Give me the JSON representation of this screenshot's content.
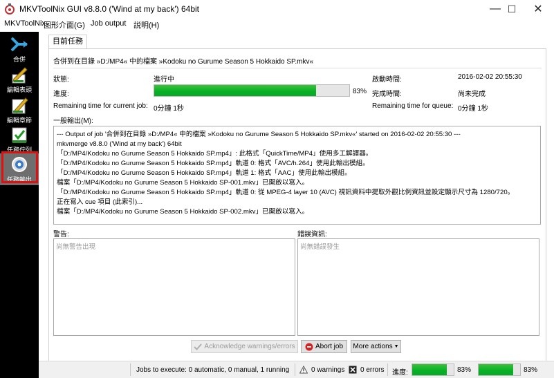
{
  "window": {
    "title": "MKVToolNix GUI v8.8.0 ('Wind at my back') 64bit",
    "minimize": "—",
    "maximize": "☐",
    "close": "✕"
  },
  "menubar": {
    "items": [
      "MKVToolNix",
      "图形介面(G)",
      "Job output",
      "説明(H)"
    ]
  },
  "sidebar": {
    "items": [
      {
        "label": "合併",
        "icon": "merge-icon"
      },
      {
        "label": "編輯表頭",
        "icon": "header-edit-icon"
      },
      {
        "label": "編輯章節",
        "icon": "chapter-edit-icon"
      },
      {
        "label": "任務佇列",
        "icon": "job-queue-icon"
      },
      {
        "label": "任務輸出",
        "icon": "job-output-icon",
        "active": true
      }
    ]
  },
  "tab": {
    "label": "目前任務"
  },
  "job": {
    "description": "合併到在目錄 »D:/MP4« 中的檔案 »Kodoku no Gurume Season 5 Hokkaido SP.mkv«",
    "status_label": "狀態:",
    "status_value": "進行中",
    "progress_label": "進度:",
    "progress_percent": 83,
    "progress_text": "83%",
    "start_label": "啟動時間:",
    "start_value": "2016-02-02 20:55:30",
    "finish_label": "完成時間:",
    "finish_value": "尚未完成",
    "remaining_job_label": "Remaining time for current job:",
    "remaining_job_value": "0分鐘 1秒",
    "remaining_queue_label": "Remaining time for queue:",
    "remaining_queue_value": "0分鐘 1秒",
    "output_label": "一般輸出(M):"
  },
  "output_lines": [
    "--- Output of job '合併到在目錄 »D:/MP4« 中的檔案 »Kodoku no Gurume Season 5 Hokkaido SP.mkv«' started on 2016-02-02 20:55:30 ---",
    "mkvmerge v8.8.0 ('Wind at my back') 64bit",
    "「D:/MP4/Kodoku no Gurume Season 5 Hokkaido SP.mp4」: 此格式「QuickTime/MP4」使用多工解譯器。",
    "「D:/MP4/Kodoku no Gurume Season 5 Hokkaido SP.mp4」軌道 0: 格式「AVC/h.264」使用此輸出模組。",
    "「D:/MP4/Kodoku no Gurume Season 5 Hokkaido SP.mp4」軌道 1: 格式「AAC」使用此輸出模組。",
    "檔案「D:/MP4/Kodoku no Gurume Season 5 Hokkaido SP-001.mkv」已開啟以寫入。",
    "「D:/MP4/Kodoku no Gurume Season 5 Hokkaido SP.mp4」軌道 0: 從 MPEG-4 layer 10 (AVC) 視訊資料中提取外觀比例資訊並設定顯示尺寸為 1280/720。",
    "正在寫入 cue 項目 (此索引)...",
    "檔案「D:/MP4/Kodoku no Gurume Season 5 Hokkaido SP-002.mkv」已開啟以寫入。"
  ],
  "warnings": {
    "label": "警告:",
    "placeholder": "尚無警告出現"
  },
  "errors": {
    "label": "錯誤資訊:",
    "placeholder": "尚無錯誤發生"
  },
  "buttons": {
    "acknowledge": "Acknowledge warnings/errors",
    "abort": "Abort job",
    "more": "More actions"
  },
  "statusbar": {
    "jobs": "Jobs to execute:  0 automatic, 0 manual, 1 running",
    "warnings": "0 warnings",
    "errors": "0 errors",
    "progress_label": "進度:",
    "progress1_percent": 83,
    "progress1_text": "83%",
    "progress2_percent": 83,
    "progress2_text": "83%"
  },
  "colors": {
    "progress_fill": "#06b025",
    "sidebar_bg": "#000000",
    "highlight": "#e01010"
  }
}
